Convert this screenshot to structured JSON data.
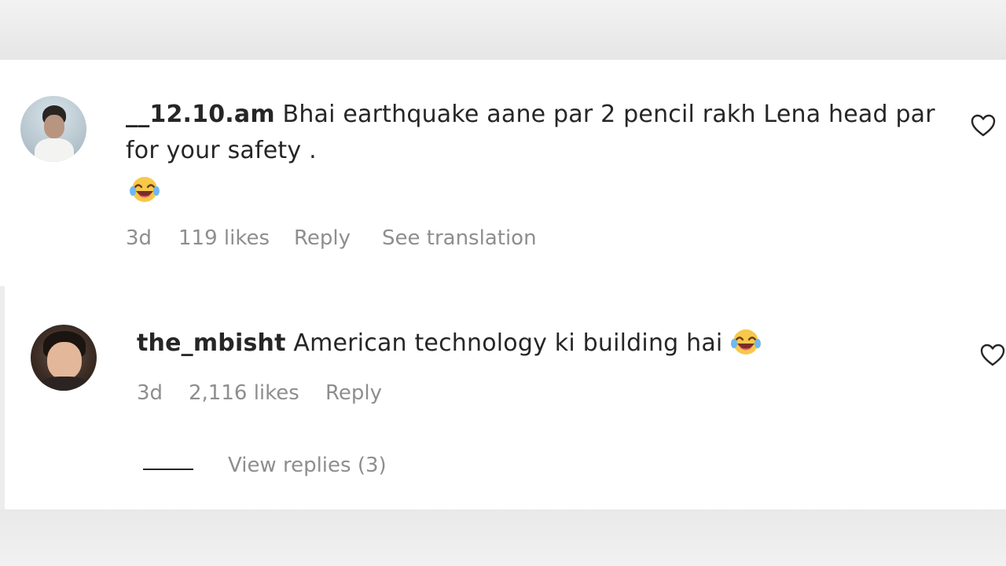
{
  "comments": [
    {
      "username": "__12.10.am",
      "text": "Bhai earthquake aane par 2 pencil rakh Lena head par for your safety .",
      "emoji": "laughing-emoji",
      "time": "3d",
      "likes": "119 likes",
      "reply_label": "Reply",
      "translate_label": "See translation"
    },
    {
      "username": "the_mbisht",
      "text": "American technology ki building hai",
      "emoji": "laughing-emoji",
      "time": "3d",
      "likes": "2,116 likes",
      "reply_label": "Reply",
      "view_replies_label": "View replies (3)"
    }
  ],
  "icons": {
    "like": "heart-outline-icon",
    "emoji": "face-with-tears-of-joy"
  },
  "colors": {
    "text": "#262626",
    "secondary": "#8e8e8e",
    "background": "#ffffff"
  }
}
